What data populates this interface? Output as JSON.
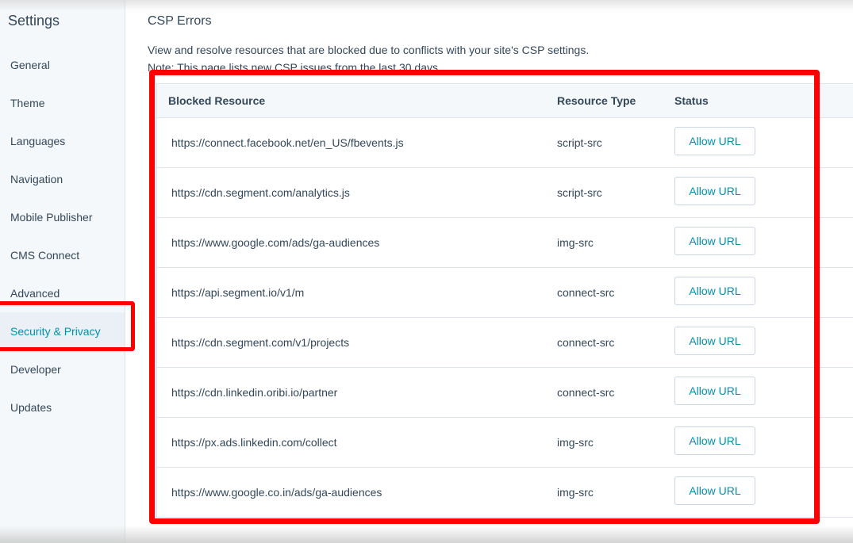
{
  "sidebar": {
    "title": "Settings",
    "items": [
      {
        "label": "General"
      },
      {
        "label": "Theme"
      },
      {
        "label": "Languages"
      },
      {
        "label": "Navigation"
      },
      {
        "label": "Mobile Publisher"
      },
      {
        "label": "CMS Connect"
      },
      {
        "label": "Advanced"
      },
      {
        "label": "Security & Privacy",
        "active": true
      },
      {
        "label": "Developer"
      },
      {
        "label": "Updates"
      }
    ]
  },
  "main": {
    "title": "CSP Errors",
    "description": "View and resolve resources that are blocked due to conflicts with your site's CSP settings.",
    "note": "Note: This page lists new CSP issues from the last 30 days",
    "table": {
      "headers": {
        "resource": "Blocked Resource",
        "type": "Resource Type",
        "status": "Status"
      },
      "rows": [
        {
          "resource": "https://connect.facebook.net/en_US/fbevents.js",
          "type": "script-src",
          "action": "Allow URL"
        },
        {
          "resource": "https://cdn.segment.com/analytics.js",
          "type": "script-src",
          "action": "Allow URL"
        },
        {
          "resource": "https://www.google.com/ads/ga-audiences",
          "type": "img-src",
          "action": "Allow URL"
        },
        {
          "resource": "https://api.segment.io/v1/m",
          "type": "connect-src",
          "action": "Allow URL"
        },
        {
          "resource": "https://cdn.segment.com/v1/projects",
          "type": "connect-src",
          "action": "Allow URL"
        },
        {
          "resource": "https://cdn.linkedin.oribi.io/partner",
          "type": "connect-src",
          "action": "Allow URL"
        },
        {
          "resource": "https://px.ads.linkedin.com/collect",
          "type": "img-src",
          "action": "Allow URL"
        },
        {
          "resource": "https://www.google.co.in/ads/ga-audiences",
          "type": "img-src",
          "action": "Allow URL"
        }
      ]
    }
  },
  "colors": {
    "accent": "#0091ae",
    "text": "#33475b",
    "annotation": "#ff0000",
    "sidebar_bg": "#f5f8fa"
  }
}
